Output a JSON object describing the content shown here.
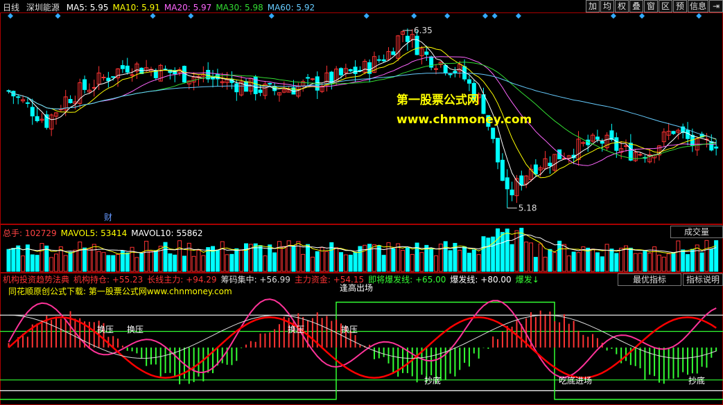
{
  "header": {
    "period": "日线",
    "stock": "深圳能源",
    "ma": [
      {
        "label": "MA5: 5.95",
        "color": "#ffffff"
      },
      {
        "label": "MA10: 5.91",
        "color": "#ffff00"
      },
      {
        "label": "MA20: 5.97",
        "color": "#ff66ff"
      },
      {
        "label": "MA30: 5.98",
        "color": "#33dd33"
      },
      {
        "label": "MA60: 5.92",
        "color": "#66ccff"
      }
    ]
  },
  "toolbar": [
    "加",
    "均",
    "权",
    "叠",
    "窗",
    "区",
    "预",
    "信息",
    "⇥"
  ],
  "price_panel": {
    "high_label": "6.35",
    "low_label": "5.18",
    "cai_label": "财",
    "watermark_cn": "第一股票公式网",
    "watermark_url": "www.chnmoney.com"
  },
  "volume_panel": {
    "labels": [
      {
        "text": "总手: ",
        "color": "#ff4444"
      },
      {
        "text": "102729",
        "color": "#ff4444"
      },
      {
        "text": "MAVOL5: 53414",
        "color": "#ffff00"
      },
      {
        "text": "MAVOL10: 55862",
        "color": "#ffffff"
      }
    ],
    "button": "成交量"
  },
  "indicator_panel": {
    "labels": [
      {
        "text": "机构投资趋势法典",
        "color": "#ff3333"
      },
      {
        "text": "机构持仓: +55.23",
        "color": "#ff3333"
      },
      {
        "text": "长线主力: +94.29",
        "color": "#ff3333"
      },
      {
        "text": "筹码集中: +56.99",
        "color": "#dddddd"
      },
      {
        "text": "主力资金: +54.15",
        "color": "#ff3333"
      },
      {
        "text": "即将爆发线: +65.00",
        "color": "#33ff33"
      },
      {
        "text": "爆发线: +80.00",
        "color": "#ffffff"
      },
      {
        "text": "爆发↓",
        "color": "#33ff33"
      }
    ],
    "subtitle": "同花顺原创公式下载: 第一股票公式网www.chnmoney.com",
    "buttons": [
      "最优指标",
      "指标说明"
    ],
    "annotations": {
      "huanya": "换压",
      "fenggao": "逢高出场",
      "chaodi": "抄底",
      "xingxiu": "吃底进场"
    }
  },
  "chart_data": {
    "type": "candlestick",
    "price_ylim": [
      5.1,
      6.45
    ],
    "high": 6.35,
    "low": 5.18,
    "ma_last": {
      "MA5": 5.95,
      "MA10": 5.91,
      "MA20": 5.97,
      "MA30": 5.98,
      "MA60": 5.92
    },
    "volume_last": 102729,
    "mavol5": 53414,
    "mavol10": 55862,
    "indicator_ylim": [
      0,
      100
    ],
    "indicator_levels": [
      80,
      65,
      20,
      10
    ],
    "indicator_last": {
      "机构持仓": 55.23,
      "长线主力": 94.29,
      "筹码集中": 56.99,
      "主力资金": 54.15
    }
  }
}
